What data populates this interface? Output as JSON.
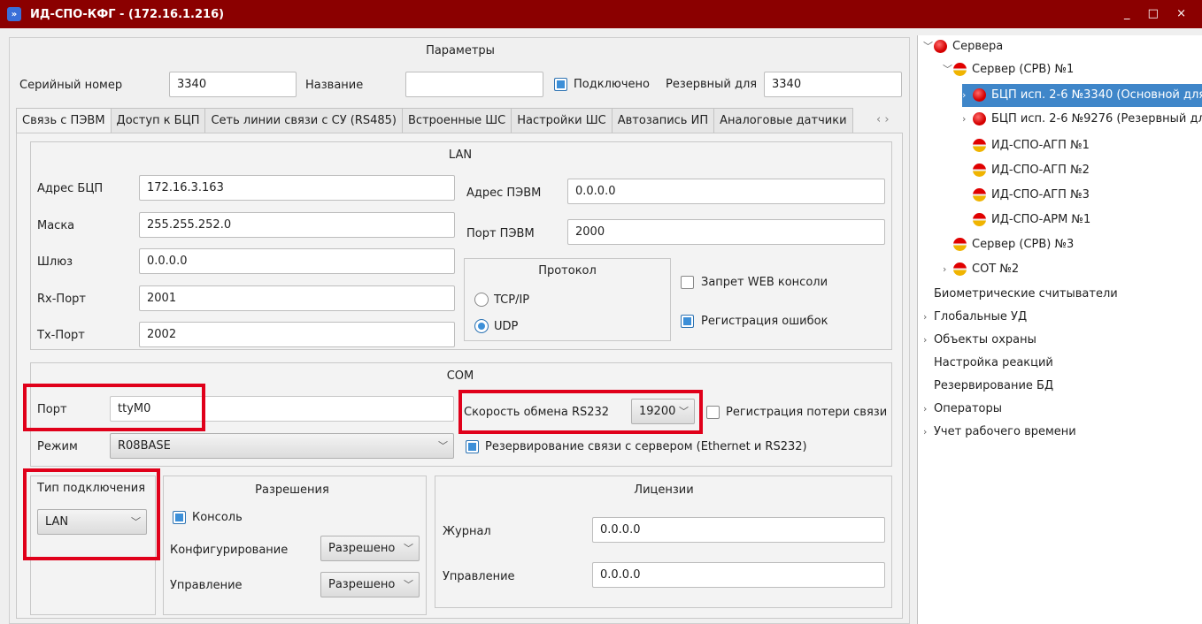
{
  "window": {
    "title": "ИД-СПО-КФГ -  (172.16.1.216)",
    "controls": "_ □ ×"
  },
  "params": {
    "title": "Параметры",
    "serial_label": "Серийный номер",
    "serial_value": "3340",
    "name_label": "Название",
    "name_value": "",
    "connected_label": "Подключено",
    "connected_checked": true,
    "reserve_label": "Резервный для",
    "reserve_value": "3340"
  },
  "tabs": [
    "Связь с ПЭВМ",
    "Доступ к БЦП",
    "Сеть линии связи с СУ (RS485)",
    "Встроенные ШС",
    "Настройки ШС",
    "Автозапись ИП",
    "Аналоговые датчики"
  ],
  "tabs_scroll": "‹ ›",
  "lan": {
    "title": "LAN",
    "addr_label": "Адрес БЦП",
    "addr_value": "172.16.3.163",
    "mask_label": "Маска",
    "mask_value": "255.255.252.0",
    "gw_label": "Шлюз",
    "gw_value": "0.0.0.0",
    "rx_label": "Rx-Порт",
    "rx_value": "2001",
    "tx_label": "Tx-Порт",
    "tx_value": "2002",
    "pc_addr_label": "Адрес ПЭВМ",
    "pc_addr_value": "0.0.0.0",
    "pc_port_label": "Порт ПЭВМ",
    "pc_port_value": "2000",
    "protocol_title": "Протокол",
    "tcp_label": "TCP/IP",
    "udp_label": "UDP",
    "web_label": "Запрет WEB консоли",
    "err_label": "Регистрация ошибок"
  },
  "com": {
    "title": "COM",
    "port_label": "Порт",
    "port_value": "ttyM0",
    "speed_label": "Скорость обмена RS232",
    "speed_value": "19200",
    "loss_label": "Регистрация потери связи",
    "mode_label": "Режим",
    "mode_value": "R08BASE",
    "backup_label": "Резервирование связи с сервером (Ethernet и RS232)"
  },
  "conn_type": {
    "title": "Тип подключения",
    "value": "LAN"
  },
  "perms": {
    "title": "Разрешения",
    "console_label": "Консоль",
    "config_label": "Конфигурирование",
    "config_value": "Разрешено",
    "control_label": "Управление",
    "control_value": "Разрешено"
  },
  "licenses": {
    "title": "Лицензии",
    "journal_label": "Журнал",
    "journal_value": "0.0.0.0",
    "control_label": "Управление",
    "control_value": "0.0.0.0"
  },
  "tree": {
    "servers": "Сервера",
    "srv1": "Сервер (СРВ) №1",
    "bcp1": "БЦП исп. 2-6 №3340 (Основной для",
    "bcp2": "БЦП исп. 2-6 №9276 (Резервный для",
    "agp1": "ИД-СПО-АГП №1",
    "agp2": "ИД-СПО-АГП №2",
    "agp3": "ИД-СПО-АГП №3",
    "arm1": "ИД-СПО-АРМ №1",
    "srv3": "Сервер (СРВ) №3",
    "sot2": "СОТ №2",
    "bio": "Биометрические считыватели",
    "global": "Глобальные УД",
    "objects": "Объекты охраны",
    "reactions": "Настройка реакций",
    "backup_db": "Резервирование БД",
    "operators": "Операторы",
    "worktime": "Учет рабочего времени"
  },
  "colors": {
    "titlebar": "#8b0000",
    "selection": "#3f86c9",
    "highlight": "#e0001a",
    "checkbox": "#3c8fd8"
  }
}
